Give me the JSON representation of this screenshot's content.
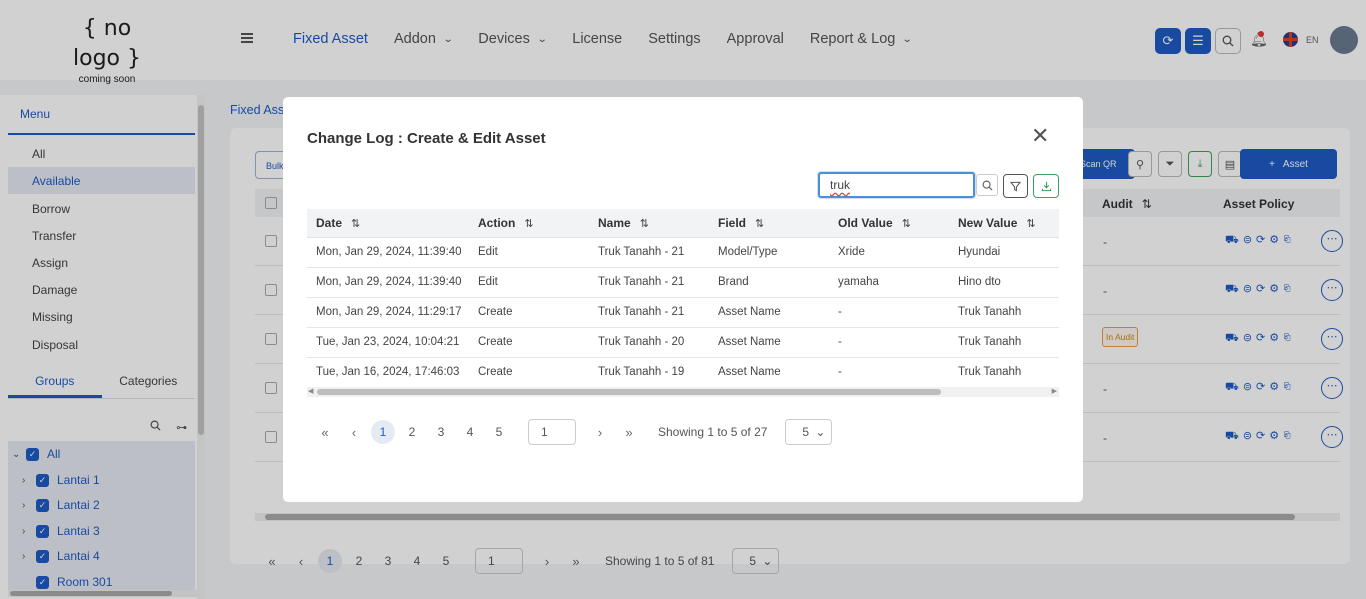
{
  "header": {
    "logo_main": "{ no logo }",
    "logo_sub": "coming soon",
    "nav": [
      {
        "label": "Fixed Asset",
        "active": true,
        "dropdown": false
      },
      {
        "label": "Addon",
        "dropdown": true
      },
      {
        "label": "Devices",
        "dropdown": true
      },
      {
        "label": "License",
        "dropdown": false
      },
      {
        "label": "Settings",
        "dropdown": false
      },
      {
        "label": "Approval",
        "dropdown": false
      },
      {
        "label": "Report & Log",
        "dropdown": true
      }
    ],
    "lang": "EN",
    "icons": [
      "refresh-icon",
      "list-icon",
      "search-icon",
      "bell-icon",
      "uk-flag-icon",
      "avatar"
    ]
  },
  "sidebar": {
    "menu_title": "Menu",
    "menu_items": [
      "All",
      "Available",
      "Borrow",
      "Transfer",
      "Assign",
      "Damage",
      "Missing",
      "Disposal"
    ],
    "active_item": "Available",
    "tabs": [
      "Groups",
      "Categories"
    ],
    "tree": [
      "All",
      "Lantai 1",
      "Lantai 2",
      "Lantai 3",
      "Lantai 4",
      "Room 301"
    ]
  },
  "background": {
    "breadcrumb": "Fixed Asset",
    "bulk_label": "Bulk",
    "scan_qr_label": "Scan QR",
    "add_asset_label": "Asset",
    "col_audit": "Audit",
    "col_policy": "Asset Policy",
    "in_audit_badge": "In Audit",
    "dash": "-",
    "pages": [
      "1",
      "2",
      "3",
      "4",
      "5"
    ],
    "page_input": "1",
    "showing": "Showing 1 to 5 of 81",
    "page_size": "5"
  },
  "modal": {
    "title": "Change Log : Create & Edit Asset",
    "search_value": "truk",
    "columns": [
      "Date",
      "Action",
      "Name",
      "Field",
      "Old Value",
      "New Value"
    ],
    "rows": [
      {
        "date": "Mon, Jan 29, 2024, 11:39:40",
        "action": "Edit",
        "name": "Truk Tanahh - 21",
        "field": "Model/Type",
        "old": "Xride",
        "new": "Hyundai"
      },
      {
        "date": "Mon, Jan 29, 2024, 11:39:40",
        "action": "Edit",
        "name": "Truk Tanahh - 21",
        "field": "Brand",
        "old": "yamaha",
        "new": "Hino dto"
      },
      {
        "date": "Mon, Jan 29, 2024, 11:29:17",
        "action": "Create",
        "name": "Truk Tanahh - 21",
        "field": "Asset Name",
        "old": "-",
        "new": "Truk Tanahh"
      },
      {
        "date": "Tue, Jan 23, 2024, 10:04:21",
        "action": "Create",
        "name": "Truk Tanahh - 20",
        "field": "Asset Name",
        "old": "-",
        "new": "Truk Tanahh"
      },
      {
        "date": "Tue, Jan 16, 2024, 17:46:03",
        "action": "Create",
        "name": "Truk Tanahh - 19",
        "field": "Asset Name",
        "old": "-",
        "new": "Truk Tanahh"
      }
    ],
    "pagination": {
      "pages": [
        "1",
        "2",
        "3",
        "4",
        "5"
      ],
      "current": "1",
      "page_input": "1",
      "showing": "Showing 1 to 5 of 27",
      "page_size": "5"
    }
  },
  "colors": {
    "primary": "#1e5bc6",
    "success": "#3aa55a",
    "warning": "#e6a23c",
    "danger": "#e53935"
  }
}
